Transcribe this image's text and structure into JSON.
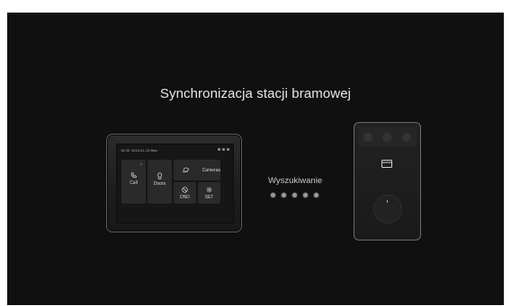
{
  "title": "Synchronizacja stacji bramowej",
  "searching_label": "Wyszukiwanie",
  "progress_dots": 5,
  "monitor": {
    "status_time": "16:35",
    "status_date": "2024-01-15  Mon",
    "tiles": {
      "call": "Call",
      "doors": "Doors",
      "camera": "Cameras",
      "dnd": "DND",
      "set": "SET"
    }
  },
  "colors": {
    "background": "#101010",
    "text": "#e8e8e8",
    "dot": "#9a9a9a"
  },
  "icons": [
    "phone-icon",
    "door-lock-icon",
    "camera-icon",
    "do-not-disturb-icon",
    "settings-icon",
    "card-reader-icon"
  ]
}
